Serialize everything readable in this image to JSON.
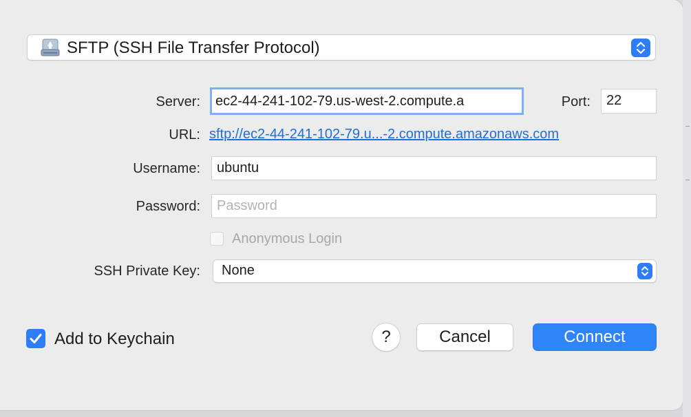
{
  "protocol": {
    "label": "SFTP (SSH File Transfer Protocol)",
    "icon": "network-drive-icon"
  },
  "server": {
    "label": "Server:",
    "value": "ec2-44-241-102-79.us-west-2.compute.a"
  },
  "port": {
    "label": "Port:",
    "value": "22"
  },
  "url": {
    "label": "URL:",
    "link": "sftp://ec2-44-241-102-79.u...-2.compute.amazonaws.com"
  },
  "username": {
    "label": "Username:",
    "value": "ubuntu"
  },
  "password": {
    "label": "Password:",
    "placeholder": "Password"
  },
  "anonymous": {
    "label": "Anonymous Login",
    "checked": false
  },
  "ssh_key": {
    "label": "SSH Private Key:",
    "value": "None"
  },
  "keychain": {
    "label": "Add to Keychain",
    "checked": true
  },
  "buttons": {
    "help": "?",
    "cancel": "Cancel",
    "connect": "Connect"
  },
  "colors": {
    "accent": "#2f84f7",
    "link": "#1f6fd6",
    "focus_ring": "#7fb0f5"
  }
}
